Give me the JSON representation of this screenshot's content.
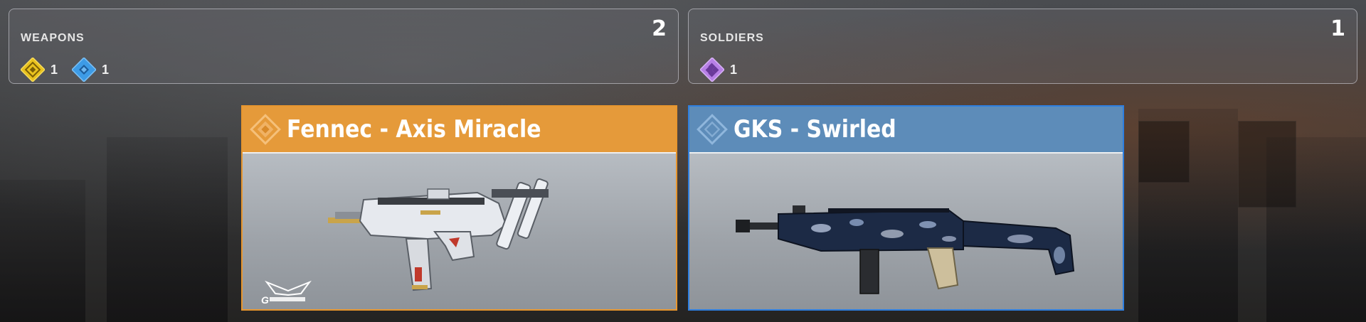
{
  "summary": {
    "weapons": {
      "title": "WEAPONS",
      "count": "2",
      "rarities": [
        {
          "icon": "legendary-gold-diamond-icon",
          "count": "1",
          "color": "#e9c21e"
        },
        {
          "icon": "rare-blue-diamond-icon",
          "count": "1",
          "color": "#3d9be6"
        }
      ]
    },
    "soldiers": {
      "title": "SOLDIERS",
      "count": "1",
      "rarities": [
        {
          "icon": "epic-purple-diamond-icon",
          "count": "1",
          "color": "#b880e6"
        }
      ]
    }
  },
  "cards": [
    {
      "name": "Fennec - Axis Miracle",
      "rarity": "legendary",
      "header_color": "#e59a3a",
      "border_color": "#e8962e",
      "icon": "legendary-diamond-icon",
      "image": "fennec-axis-miracle-weapon-image"
    },
    {
      "name": "GKS - Swirled",
      "rarity": "rare",
      "header_color": "#5d8cb9",
      "border_color": "#2e7fe0",
      "icon": "rare-diamond-icon",
      "image": "gks-swirled-weapon-image"
    }
  ]
}
